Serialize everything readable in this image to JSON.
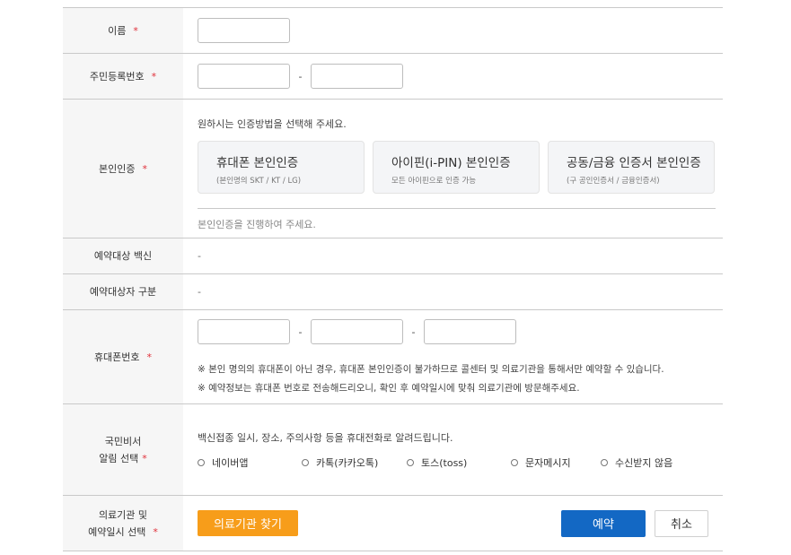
{
  "required_mark": "*",
  "name": {
    "label": "이름",
    "value": ""
  },
  "rrn": {
    "label": "주민등록번호",
    "sep": "-",
    "front": "",
    "back": ""
  },
  "auth": {
    "label": "본인인증",
    "desc": "원하시는 인증방법을 선택해 주세요.",
    "options": [
      {
        "title": "휴대폰 본인인증",
        "sub": "(본인명의 SKT / KT / LG)"
      },
      {
        "title": "아이핀(i-PIN) 본인인증",
        "sub": "모든 아이핀으로 인증 가능"
      },
      {
        "title": "공동/금융 인증서 본인인증",
        "sub": "(구 공인인증서 / 금융인증서)"
      }
    ],
    "note": "본인인증을 진행하여 주세요."
  },
  "vaccine": {
    "label": "예약대상 백신",
    "value": "-"
  },
  "target_type": {
    "label": "예약대상자 구분",
    "value": "-"
  },
  "phone": {
    "label": "휴대폰번호",
    "sep": "-",
    "notes": [
      "※ 본인 명의의 휴대폰이 아닌 경우, 휴대폰 본인인증이 불가하므로 콜센터 및 의료기관을 통해서만 예약할 수 있습니다.",
      "※ 예약정보는 휴대폰 번호로 전송해드리오니, 확인 후 예약일시에 맞춰 의료기관에 방문해주세요."
    ]
  },
  "alert": {
    "label_line1": "국민비서",
    "label_line2": "알림 선택",
    "desc": "백신접종 일시, 장소, 주의사항 등을 휴대전화로 알려드립니다.",
    "options": [
      "네이버앱",
      "카톡(카카오톡)",
      "토스(toss)",
      "문자메시지",
      "수신받지 않음"
    ]
  },
  "hospital": {
    "label_line1": "의료기관 및",
    "label_line2": "예약일시 선택",
    "find_button": "의료기관 찾기",
    "book_button": "예약",
    "cancel_button": "취소"
  }
}
